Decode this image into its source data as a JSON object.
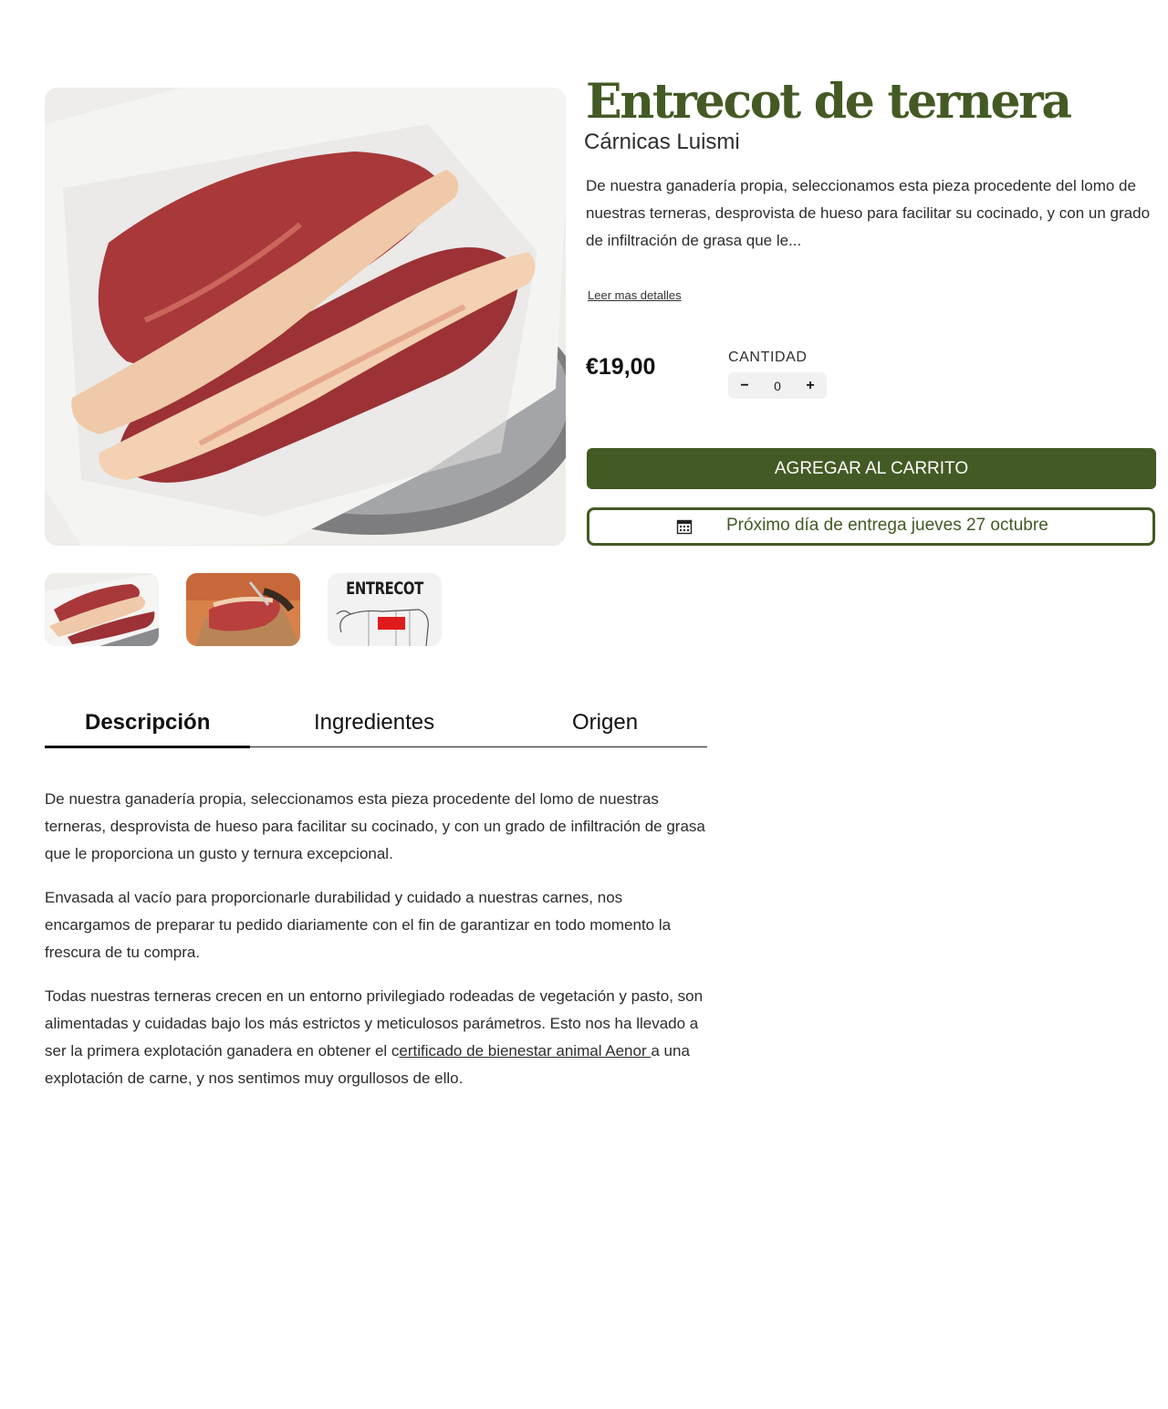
{
  "product": {
    "title": "Entrecot de ternera",
    "vendor": "Cárnicas Luismi",
    "short_description": "De nuestra ganadería propia, seleccionamos esta pieza procedente del lomo de nuestras terneras, desprovista de hueso para facilitar su cocinado, y con un grado de infiltración de grasa que le...",
    "read_more_label": "Leer mas detalles",
    "price": "€19,00",
    "brand_color": "#435a24"
  },
  "quantity": {
    "label": "CANTIDAD",
    "value": "0",
    "minus": "−",
    "plus": "+"
  },
  "cart": {
    "add_label": "AGREGAR AL CARRITO"
  },
  "delivery": {
    "icon": "calendar-icon",
    "text": "Próximo día de entrega jueves 27 octubre"
  },
  "thumbnails": [
    {
      "name": "thumbnail-entrecot-plate"
    },
    {
      "name": "thumbnail-cutting-meat"
    },
    {
      "name": "thumbnail-cut-diagram",
      "text": "ENTRECOT"
    }
  ],
  "tabs": [
    {
      "label": "Descripción",
      "active": true
    },
    {
      "label": "Ingredientes",
      "active": false
    },
    {
      "label": "Origen",
      "active": false
    }
  ],
  "description": {
    "p1": "De nuestra ganadería propia, seleccionamos esta pieza procedente del lomo de nuestras terneras, desprovista de hueso para facilitar su cocinado, y con un grado de infiltración de grasa que le proporciona un gusto y ternura excepcional.",
    "p2": "Envasada al vacío para proporcionarle durabilidad y cuidado a nuestras carnes, nos encargamos de preparar tu pedido diariamente con el fin de garantizar en todo momento la frescura de tu compra.",
    "p3_before": "Todas nuestras terneras crecen en un entorno privilegiado rodeadas de vegetación y pasto, son alimentadas y cuidadas bajo los más estrictos y meticulosos parámetros. Esto nos ha llevado a ser la primera explotación ganadera en obtener el c",
    "p3_link": "ertificado de bienestar animal Aenor ",
    "p3_after": "a una explotación de carne, y nos sentimos muy orgullosos de ello."
  }
}
